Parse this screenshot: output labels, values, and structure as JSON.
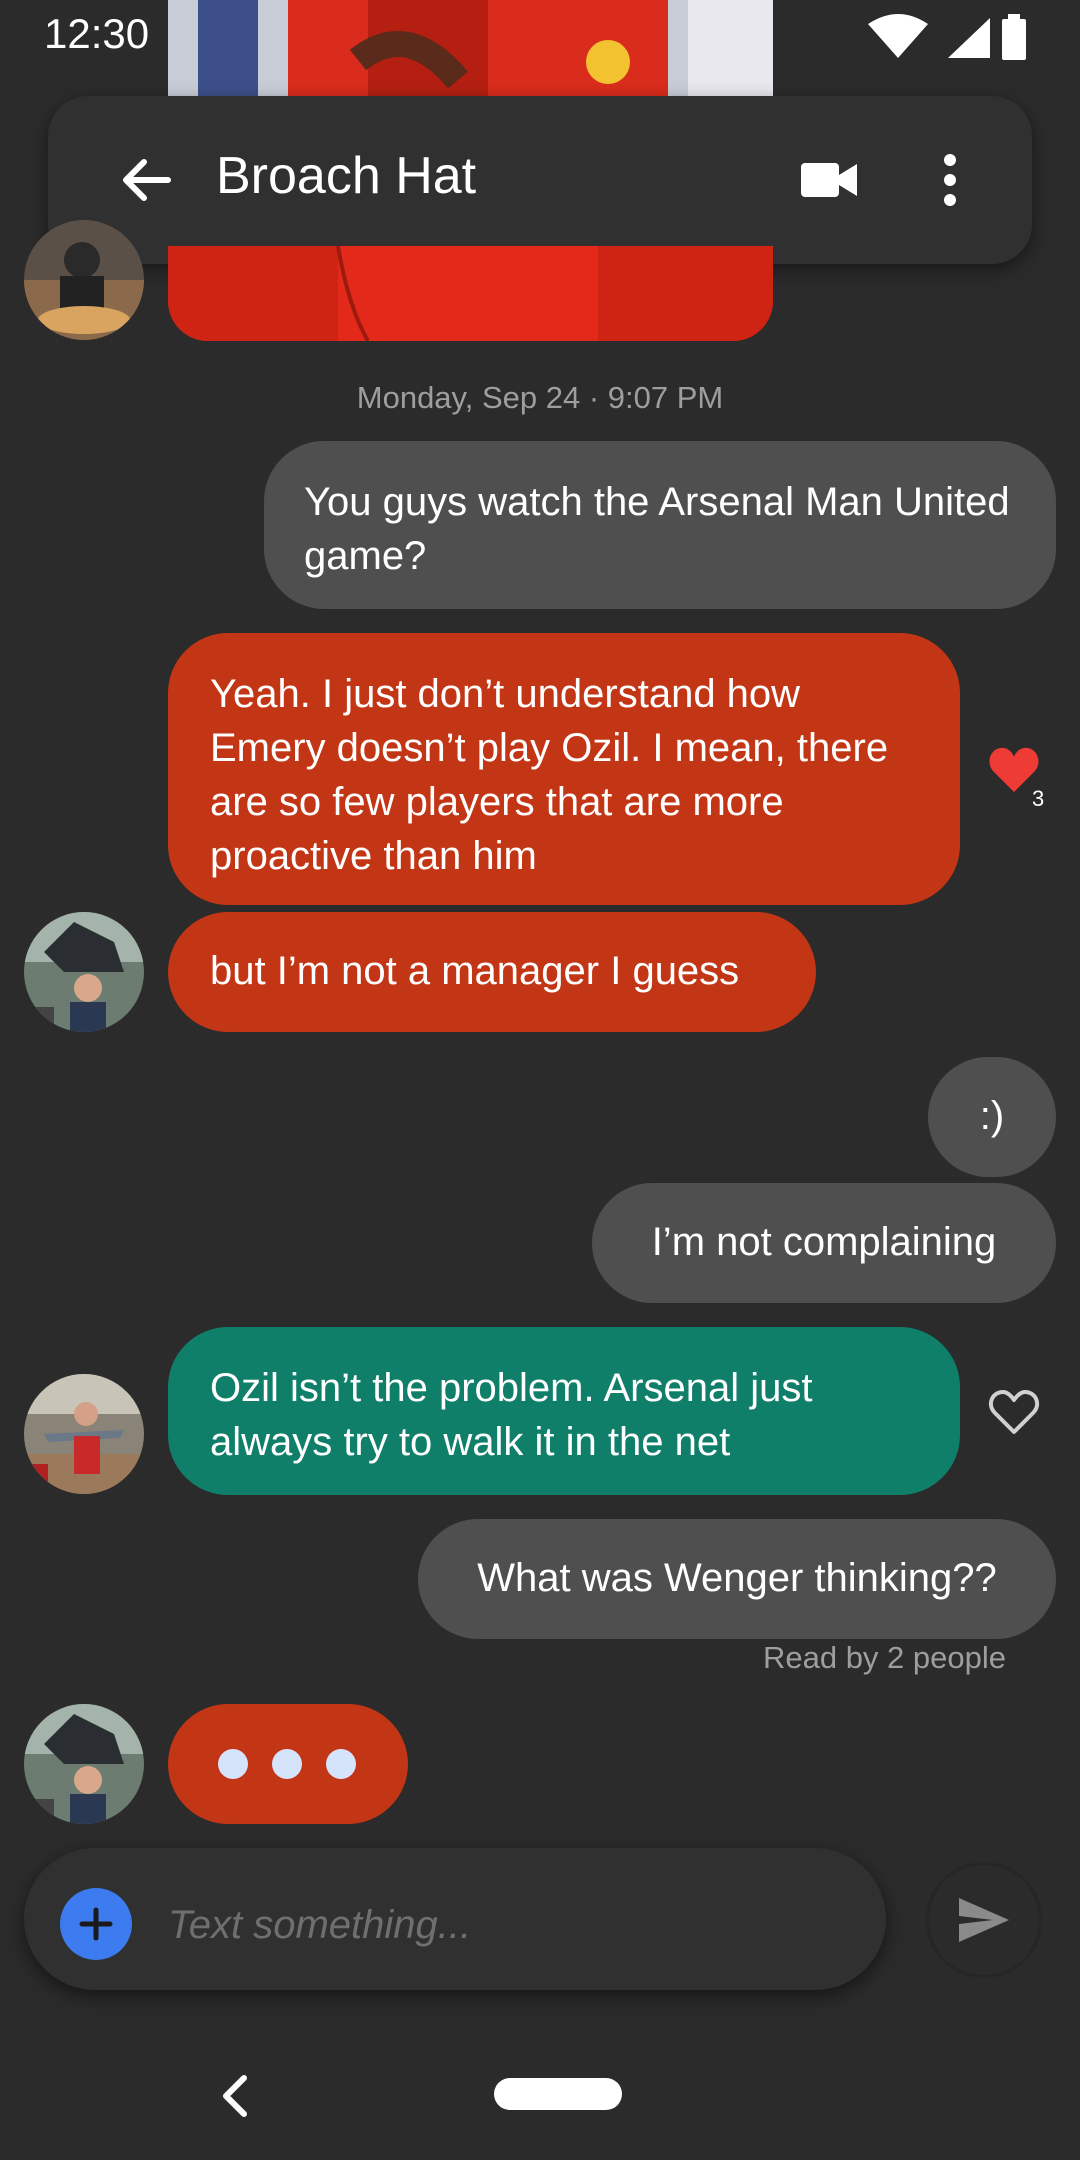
{
  "status_bar": {
    "time": "12:30",
    "icons": [
      "wifi-icon",
      "signal-icon",
      "battery-icon"
    ]
  },
  "toolbar": {
    "title": "Broach Hat",
    "icons": [
      "back-arrow-icon",
      "video-call-icon",
      "more-vert-icon"
    ]
  },
  "conversation": {
    "date_label": "Monday, Sep 24 · 9:07 PM",
    "messages": [
      {
        "from": "me",
        "text": "You guys watch the Arsenal Man United game?"
      },
      {
        "from": "contact",
        "color": "#c23515",
        "text": "Yeah. I just don’t understand how Emery doesn’t play Ozil. I mean, there are so few players that are more proactive than him",
        "reaction_count": "3"
      },
      {
        "from": "contact",
        "color": "#c23515",
        "text": "but I’m not a manager I guess"
      },
      {
        "from": "me",
        "text": ":)"
      },
      {
        "from": "me",
        "text": "I’m not complaining"
      },
      {
        "from": "contact",
        "color": "#107f69",
        "text": "Ozil isn’t the problem. Arsenal just always try to walk it in the net"
      },
      {
        "from": "me",
        "text": "What was Wenger thinking??"
      }
    ],
    "read_receipt": "Read by 2 people"
  },
  "composer": {
    "placeholder": "Text something..."
  },
  "colors": {
    "background": "#2b2b2b",
    "outgoing_bubble": "#4f4f4f",
    "red_bubble": "#c23515",
    "teal_bubble": "#107f69",
    "accent_blue": "#3c7bf0",
    "heart_red": "#ef3b36"
  }
}
